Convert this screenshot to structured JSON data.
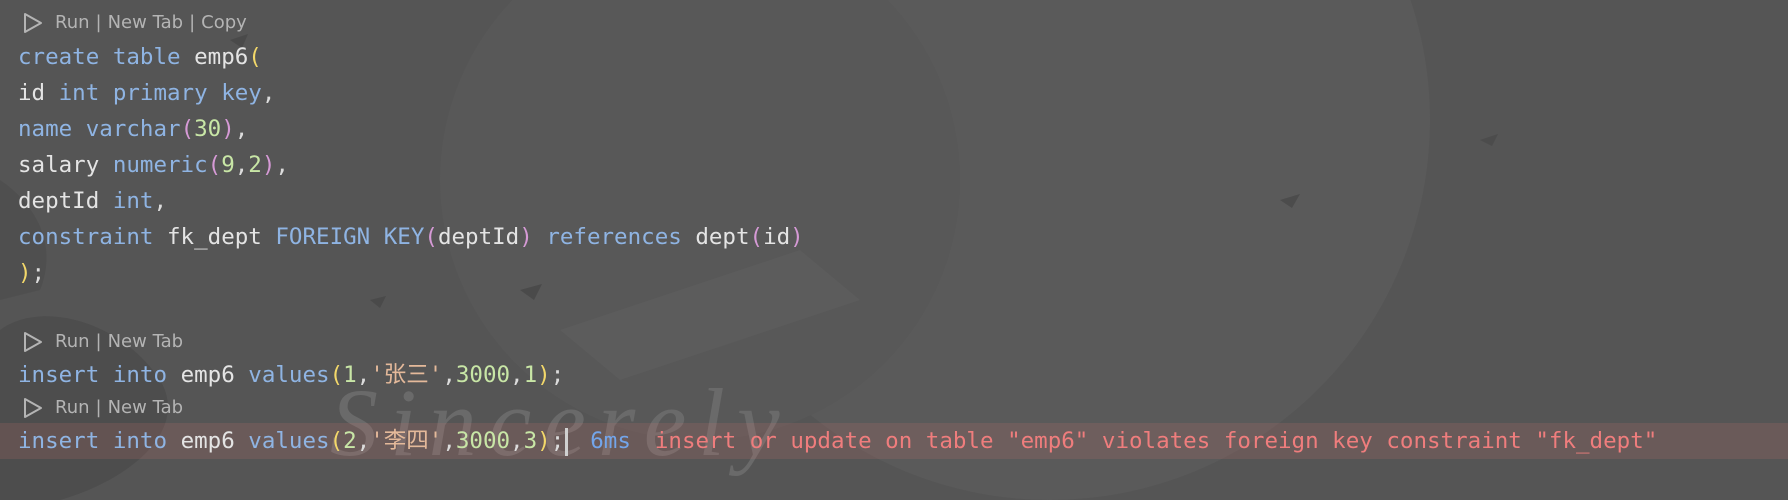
{
  "codelens": {
    "run": "Run",
    "new_tab": "New Tab",
    "copy": "Copy",
    "separator": "|"
  },
  "code": {
    "l1": {
      "t1": "create",
      "t2": "table",
      "t3": "emp6",
      "t4": "("
    },
    "l2": {
      "t1": "id",
      "t2": "int",
      "t3": "primary",
      "t4": "key",
      "t5": ","
    },
    "l3": {
      "t1": "name",
      "t2": "varchar",
      "t3": "(",
      "t4": "30",
      "t5": ")",
      "t6": ","
    },
    "l4": {
      "t1": "salary",
      "t2": "numeric",
      "t3": "(",
      "t4": "9",
      "t5": ",",
      "t6": "2",
      "t7": ")",
      "t8": ","
    },
    "l5": {
      "t1": "deptId",
      "t2": "int",
      "t3": ","
    },
    "l6": {
      "t1": "constraint",
      "t2": "fk_dept",
      "t3": "FOREIGN",
      "t4": "KEY",
      "t5": "(",
      "t6": "deptId",
      "t7": ")",
      "t8": "references",
      "t9": "dept",
      "t10": "(",
      "t11": "id",
      "t12": ")"
    },
    "l7": {
      "t1": ")",
      "t2": ";"
    },
    "l8": {
      "t1": "insert",
      "t2": "into",
      "t3": "emp6",
      "t4": "values",
      "t5": "(",
      "t6": "1",
      "t7": ",",
      "t8": "'张三'",
      "t9": ",",
      "t10": "3000",
      "t11": ",",
      "t12": "1",
      "t13": ")",
      "t14": ";"
    },
    "l9": {
      "t1": "insert",
      "t2": "into",
      "t3": "emp6",
      "t4": "values",
      "t5": "(",
      "t6": "2",
      "t7": ",",
      "t8": "'李四'",
      "t9": ",",
      "t10": "3000",
      "t11": ",",
      "t12": "3",
      "t13": ")",
      "t14": ";"
    }
  },
  "result": {
    "duration": "6ms",
    "error": "insert or update on table \"emp6\" violates foreign key constraint \"fk_dept\""
  },
  "colors": {
    "background": "#555555",
    "keyword": "#8fb4e3",
    "number": "#c8e6a6",
    "string": "#e4b99a",
    "bracket_outer": "#f3d86a",
    "bracket_inner": "#d69ad6",
    "error": "#ef7d7d",
    "duration": "#73a5ea"
  },
  "icons": {
    "codelens_run": "play-icon"
  }
}
